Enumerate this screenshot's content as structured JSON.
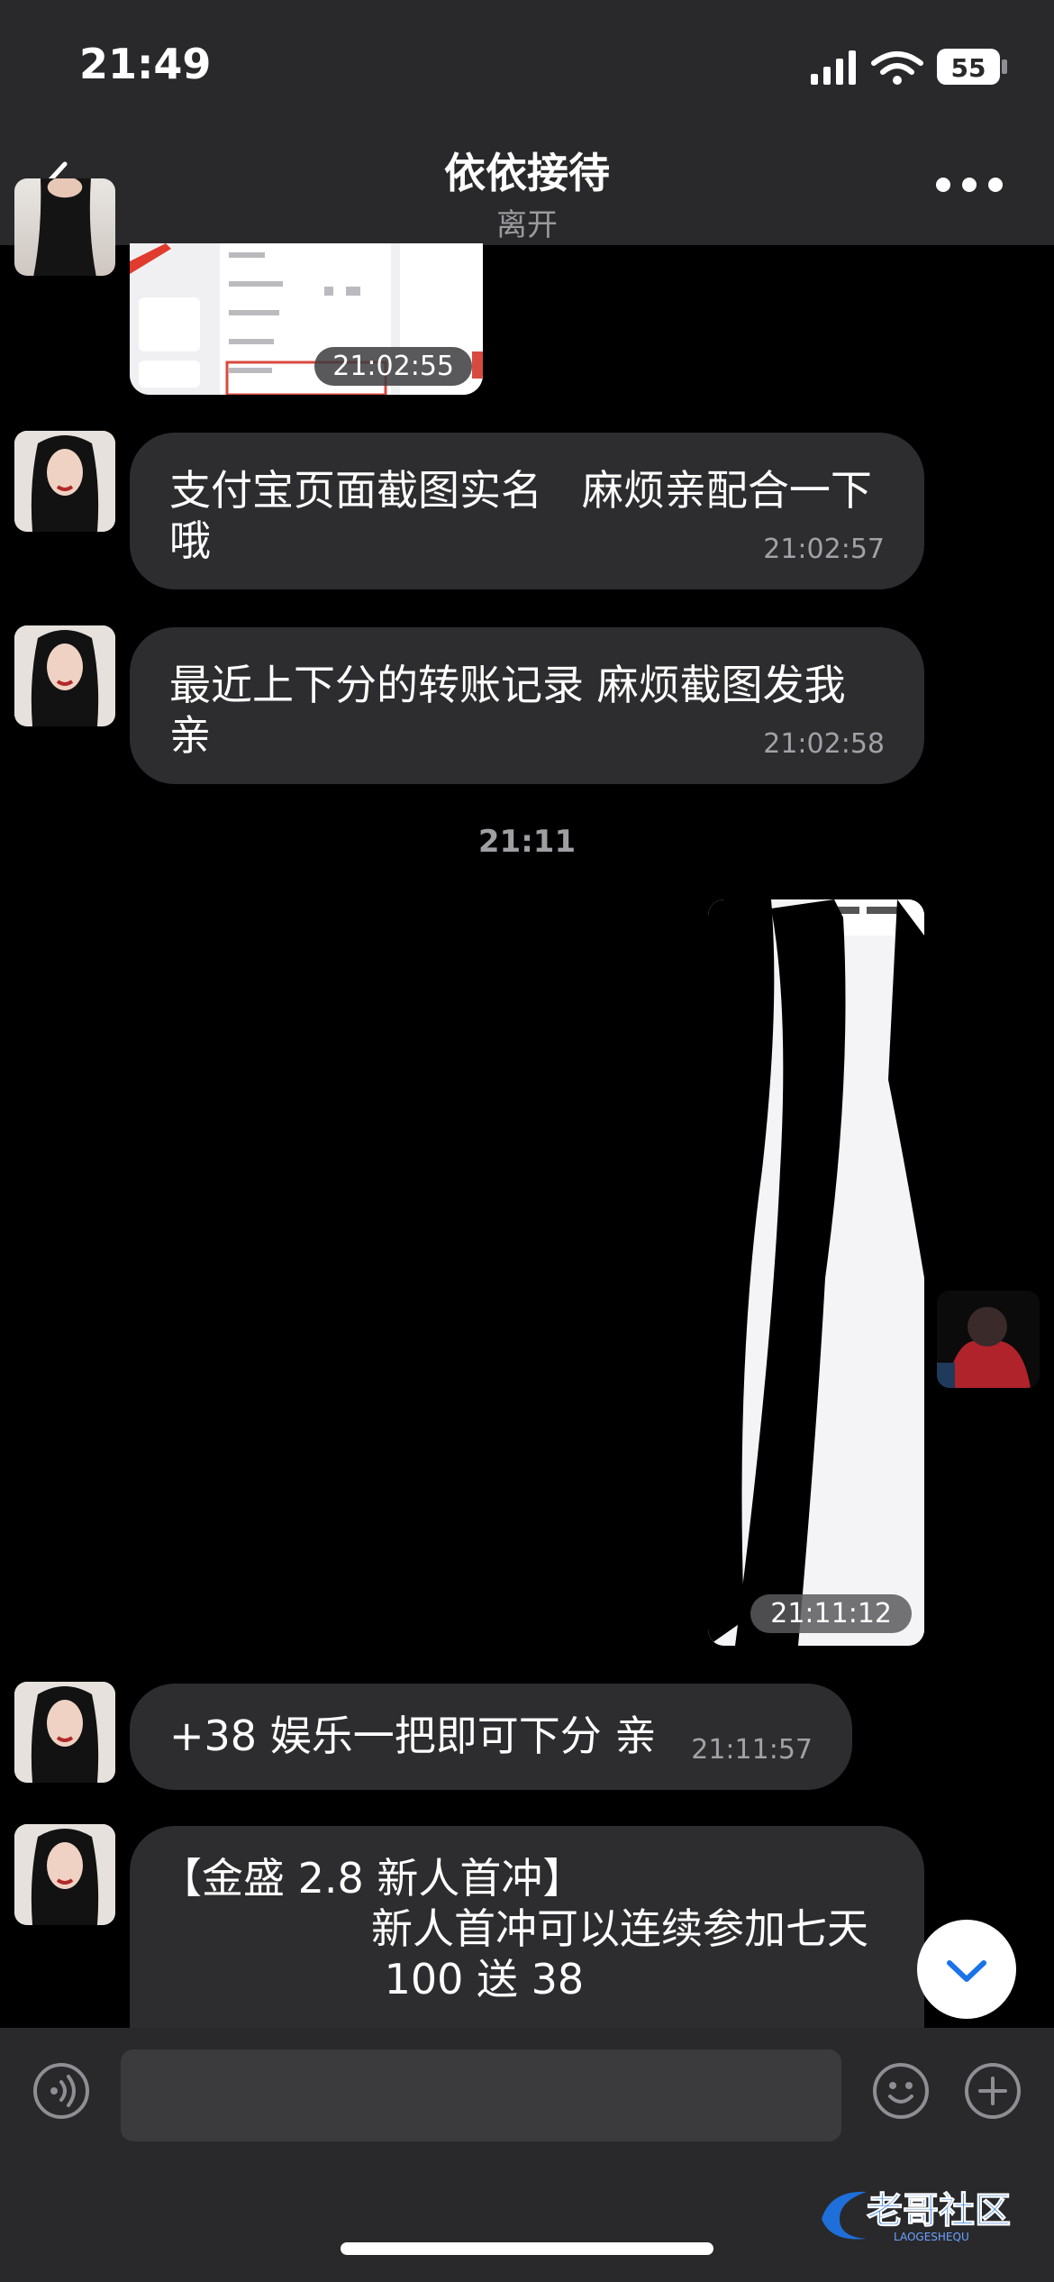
{
  "status_bar": {
    "time": "21:49",
    "battery": "55"
  },
  "nav": {
    "title": "依依接待",
    "subtitle": "离开"
  },
  "messages": [
    {
      "text": "支付宝页面截图实名   麻烦亲配合一下哦",
      "time": "21:02:57"
    },
    {
      "text": "最近上下分的转账记录 麻烦截图发我 亲",
      "time": "21:02:58"
    },
    {
      "text": "+38 娱乐一把即可下分 亲",
      "time": "21:11:57"
    },
    {
      "text": "【金盛 2.8 新人首冲】\n                新人首冲可以连续参加七天\n                 100 送 38"
    }
  ],
  "images": {
    "top_image_time": "21:02:55",
    "sent_image_time": "21:11:12"
  },
  "divider_time": "21:11",
  "watermark": "老哥社区",
  "watermark_sub": "LAOGESHEQU",
  "colors": {
    "header": "#29292b",
    "bubble": "#2d2d2f",
    "background": "#000000"
  },
  "icons": [
    "back-icon",
    "more-icon",
    "voice-icon",
    "emoji-icon",
    "plus-icon",
    "chevron-down-icon"
  ]
}
